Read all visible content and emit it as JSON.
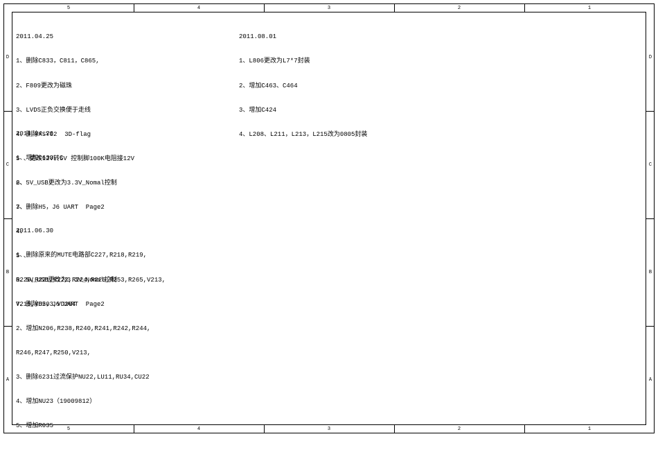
{
  "ruler": {
    "cols": [
      "5",
      "4",
      "3",
      "2",
      "1"
    ],
    "rows": [
      "D",
      "C",
      "B",
      "A"
    ]
  },
  "notes": {
    "block1": {
      "date": "2011.04.25",
      "items": [
        "1、删除C833，C811，C865,",
        "2、F809更改为磁珠",
        "3、LVDS正负交换便于走线",
        "4、删除XSY02  3D-flag",
        "5 、更改12V转5V 控制脚100K电阻接12V",
        "6、5V_USB更改为3.3V_Nomal控制",
        "7、删除H5，J6 UART  Page2"
      ]
    },
    "block2": {
      "date": "2011.04.26",
      "items": [
        "1、增加C633，C",
        "2、",
        "3、",
        "4、",
        "5 、",
        "6、5V_USB更改为3.3V_Nomal控制",
        "7、删除H5，J6 UART  Page2"
      ]
    },
    "block3": {
      "date": "2011.06.30",
      "items": [
        "1、删除原来的MUTE电路部C227,R218,R219,",
        "R220,R221,R222,R224,R226,R253,R265,V213,",
        "V215,VD203,VD204",
        "2、增加N206,R238,R240,R241,R242,R244,",
        "R246,R247,R250,V213,",
        "3、删除6231过流保护NU22,LU11,RU34,CU22",
        "4、增加NU23（19009812）",
        "5、增加R035"
      ]
    },
    "block4": {
      "date": "2011.08.01",
      "items": [
        "1、L806更改为L7*7封装",
        "2、增加C463、C464",
        "3、增加C424",
        "4、L208、L211，L213，L215改为0805封装"
      ]
    }
  }
}
